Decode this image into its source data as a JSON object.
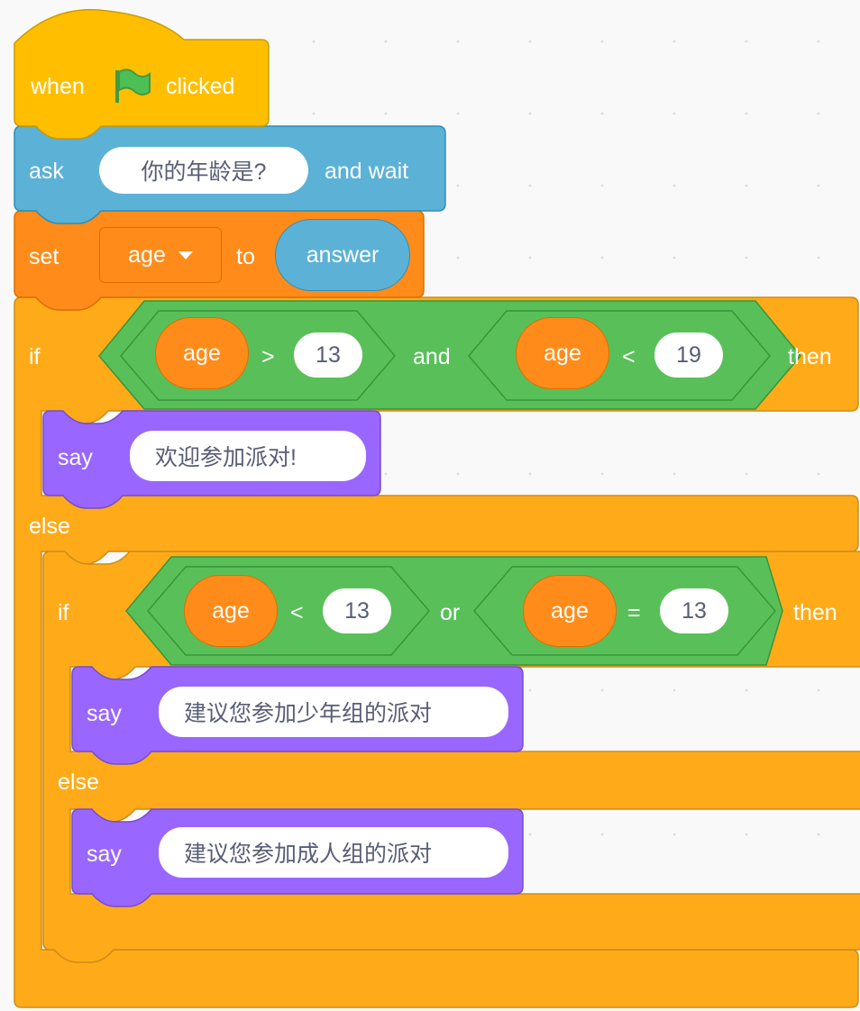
{
  "colors": {
    "events": "#ffbf00",
    "sensing": "#5cb1d6",
    "variables": "#ff8c1a",
    "control": "#ffab19",
    "operators": "#59c059",
    "looks": "#9966ff"
  },
  "hat": {
    "when": "when",
    "icon": "green-flag-icon",
    "clicked": "clicked"
  },
  "ask": {
    "label": "ask",
    "question": "你的年龄是?",
    "and_wait": "and wait"
  },
  "set_var": {
    "label": "set",
    "variable": "age",
    "to": "to",
    "value": "answer"
  },
  "if1": {
    "if_label": "if",
    "left": {
      "var": "age",
      "op": ">",
      "value": "13"
    },
    "joiner": "and",
    "right": {
      "var": "age",
      "op": "<",
      "value": "19"
    },
    "then_label": "then",
    "say": {
      "label": "say",
      "message": "欢迎参加派对!"
    },
    "else_label": "else"
  },
  "if2": {
    "if_label": "if",
    "left": {
      "var": "age",
      "op": "<",
      "value": "13"
    },
    "joiner": "or",
    "right": {
      "var": "age",
      "op": "=",
      "value": "13"
    },
    "then_label": "then",
    "say_then": {
      "label": "say",
      "message": "建议您参加少年组的派对"
    },
    "else_label": "else",
    "say_else": {
      "label": "say",
      "message": "建议您参加成人组的派对"
    }
  }
}
